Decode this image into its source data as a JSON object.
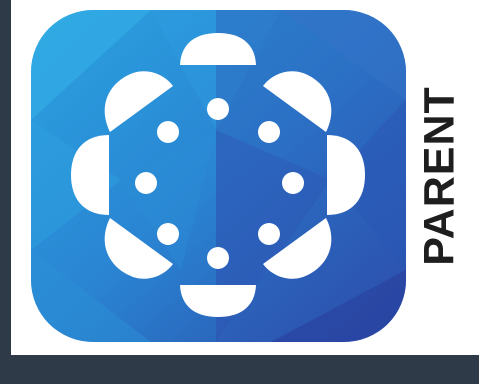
{
  "app": {
    "label": "PARENT",
    "icon_name": "canvas-logo-icon"
  },
  "colors": {
    "background": "#2f3a48",
    "panel": "#ffffff",
    "icon_blue_light": "#2a9ad8",
    "icon_blue_dark": "#2d4fae",
    "logo_white": "#ffffff",
    "label_text": "#1e1e1e"
  }
}
